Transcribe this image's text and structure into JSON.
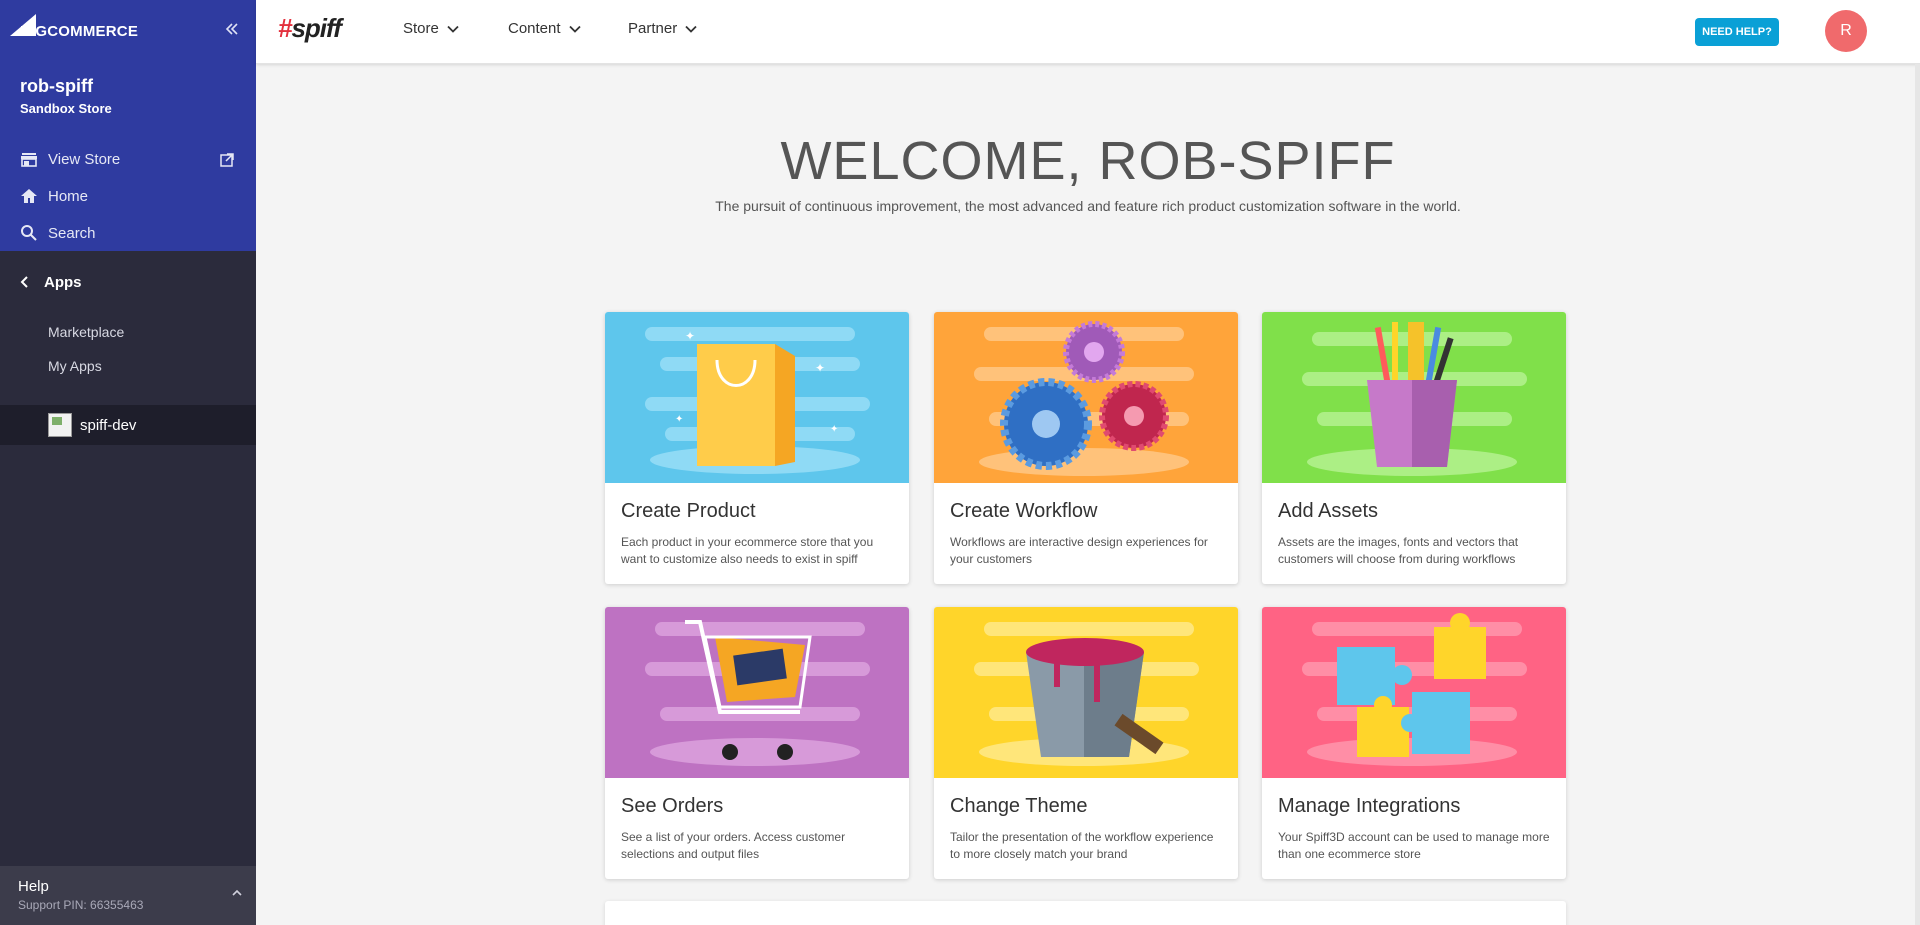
{
  "sidebar": {
    "brand": "BIGCOMMERCE",
    "store_name": "rob-spiff",
    "store_type": "Sandbox Store",
    "links": [
      {
        "label": "View Store",
        "icon": "store-icon"
      },
      {
        "label": "Home",
        "icon": "home-icon"
      },
      {
        "label": "Search",
        "icon": "search-icon"
      }
    ],
    "apps_label": "Apps",
    "apps_sub": [
      "Marketplace",
      "My Apps"
    ],
    "active_app": "spiff-dev",
    "help": {
      "title": "Help",
      "pin": "Support PIN: 66355463"
    }
  },
  "topbar": {
    "logo_hash": "#",
    "logo_text": "spiff",
    "nav": [
      "Store",
      "Content",
      "Partner"
    ],
    "help_button": "NEED HELP?",
    "avatar_initial": "R"
  },
  "main": {
    "welcome": "WELCOME, ROB-SPIFF",
    "tagline": "The pursuit of continuous improvement, the most advanced and feature rich product customization software in the world.",
    "cards": [
      {
        "title": "Create Product",
        "desc": "Each product in your ecommerce store that you want to customize also needs to exist in spiff",
        "bg": "#5ec6ec"
      },
      {
        "title": "Create Workflow",
        "desc": "Workflows are interactive design experiences for your customers",
        "bg": "#ffa43a"
      },
      {
        "title": "Add Assets",
        "desc": "Assets are the images, fonts and vectors that customers will choose from during workflows",
        "bg": "#80e04a"
      },
      {
        "title": "See Orders",
        "desc": "See a list of your orders. Access customer selections and output files",
        "bg": "#be72c2"
      },
      {
        "title": "Change Theme",
        "desc": "Tailor the presentation of the workflow experience to more closely match your brand",
        "bg": "#ffd52a"
      },
      {
        "title": "Manage Integrations",
        "desc": "Your Spiff3D account can be used to manage more than one ecommerce store",
        "bg": "#ff6384"
      }
    ]
  },
  "colors": {
    "sidebar_top": "#2f3ba0",
    "sidebar_dark": "#2b2b3c",
    "accent_button": "#0aa0d6",
    "avatar": "#f06a6c",
    "spiff_hash": "#e3303d"
  }
}
